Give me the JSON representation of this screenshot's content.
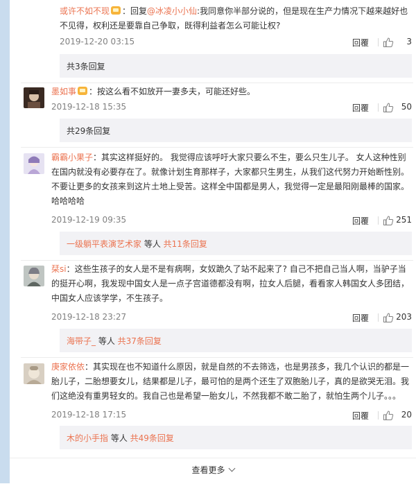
{
  "top_reply": {
    "user": "或许不如不现",
    "reply_prefix": "：回复",
    "mention": "@冰凌小小仙",
    "text": ":我同意你半部分说的，但是现在生产力情况下越来越好也不见得，权利还是要靠自己争取，既得利益者怎么可能让权?",
    "time": "2019-12-20 03:15",
    "reply_label": "回覆",
    "likes": "3"
  },
  "top_more": "共3条回复",
  "comments": [
    {
      "user": "墨如事",
      "text": "：按这么看不如放开一妻多夫，可能还好些。",
      "time": "2019-12-18 15:35",
      "reply_label": "回覆",
      "likes": "50",
      "sub": {
        "names": "",
        "connector": "",
        "more": "共29条回复"
      }
    },
    {
      "user": "霸霸小果子",
      "text": "：其实这样挺好的。 我觉得应该呼吁大家只要么不生，要么只生儿子。 女人这种性别在国内就没有必要存在了。就像计划生育那样子，大家都只生男生，从我们这代努力开始断性别。不要让更多的女孩来到这片土地上受苦。这样全中国都是男人，我觉得一定是最阳刚最棒的国家。哈哈哈哈",
      "time": "2019-12-19 09:35",
      "reply_label": "回覆",
      "likes": "251",
      "sub": {
        "names": "一级躺平表演艺术家",
        "connector": " 等人 ",
        "more": "共11条回复"
      }
    },
    {
      "user": "栞si",
      "text": "：这些生孩子的女人是不是有病啊，女奴跪久了站不起来了? 自己不把自己当人啊，当驴子当的挺开心啊，我发现中国女人是一点子宫道德都没有啊，拉女人后腿，看看家人韩国女人多团结，中国女人应该学学，不生孩子。",
      "time": "2019-12-18 23:27",
      "reply_label": "回覆",
      "likes": "203",
      "sub": {
        "names": "海带子_",
        "connector": " 等人 ",
        "more": "共37条回复"
      }
    },
    {
      "user": "庚家依依",
      "text": "：其实现在也不知道什么原因，就是自然的不去筛选，也是男孩多，我几个认识的都是一胎儿子，二胎想要女儿，结果都是儿子，最可怕的是两个还生了双胞胎儿子，真的是欲哭无泪。我们这绝没有重男轻女的。我自己也是希望一胎女儿，不然我都不敢二胎了，就怕生两个儿子。。。",
      "time": "2019-12-18 17:15",
      "reply_label": "回覆",
      "likes": "20",
      "sub": {
        "names": "木的小手指",
        "connector": " 等人 ",
        "more": "共49条回复"
      }
    }
  ],
  "see_more": "查看更多",
  "colors": {
    "accent": "#eb7350",
    "left_bar": "#c9dcee",
    "sub_bg": "#f2f2f5"
  }
}
